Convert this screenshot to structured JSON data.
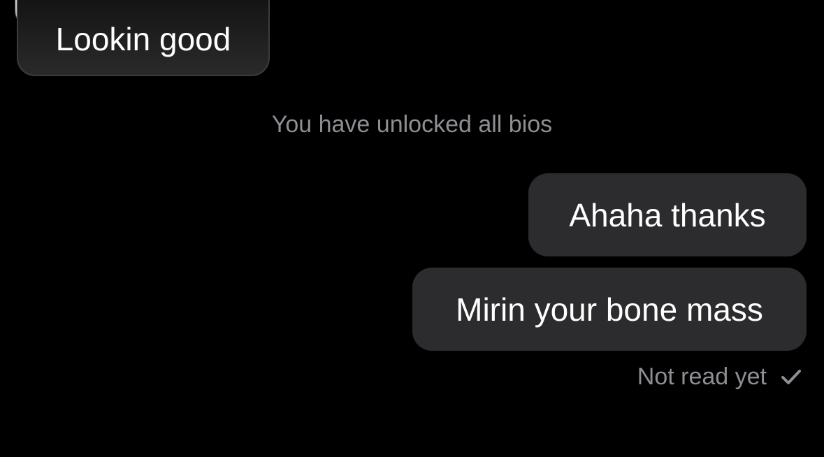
{
  "conversation": {
    "received": {
      "text": "Lookin good"
    },
    "system_note": "You have unlocked all bios",
    "sent": [
      {
        "text": "Ahaha thanks"
      },
      {
        "text": "Mirin your bone mass"
      }
    ],
    "receipt": {
      "status": "Not read yet",
      "icon": "checkmark-icon"
    }
  },
  "colors": {
    "background": "#000000",
    "sent_bubble": "#2c2c2e",
    "text": "#ffffff",
    "muted_text": "#8e8e93"
  }
}
